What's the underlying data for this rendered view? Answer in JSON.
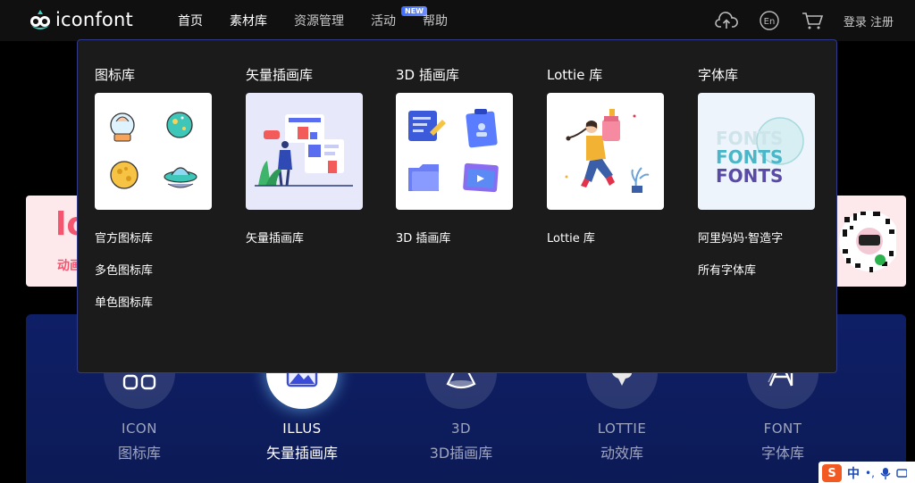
{
  "header": {
    "logo_text": "iconfont",
    "nav": [
      {
        "label": "首页",
        "active": true
      },
      {
        "label": "素材库",
        "active": true
      },
      {
        "label": "资源管理",
        "active": false
      },
      {
        "label": "活动",
        "active": false,
        "badge": "NEW"
      },
      {
        "label": "帮助",
        "active": false
      }
    ],
    "lang_label": "En",
    "login": "登录",
    "register": "注册"
  },
  "dropdown": {
    "columns": [
      {
        "title": "图标库",
        "links": [
          "官方图标库",
          "多色图标库",
          "单色图标库"
        ]
      },
      {
        "title": "矢量插画库",
        "links": [
          "矢量插画库"
        ]
      },
      {
        "title": "3D 插画库",
        "links": [
          "3D 插画库"
        ]
      },
      {
        "title": "Lottie 库",
        "links": [
          "Lottie 库"
        ]
      },
      {
        "title": "字体库",
        "links": [
          "阿里妈妈·智造字",
          "所有字体库"
        ],
        "card_text": [
          "FONTS",
          "FONTS",
          "FONTS"
        ]
      }
    ]
  },
  "banner": {
    "left_big": "lo",
    "left_sub": "动画"
  },
  "categories": [
    {
      "en": "ICON",
      "cn": "图标库",
      "icon": "grid-icon",
      "active": false
    },
    {
      "en": "ILLUS",
      "cn": "矢量插画库",
      "icon": "picture-icon",
      "active": true
    },
    {
      "en": "3D",
      "cn": "3D插画库",
      "icon": "cone-icon",
      "active": false
    },
    {
      "en": "LOTTIE",
      "cn": "动效库",
      "icon": "lottie-icon",
      "active": false
    },
    {
      "en": "FONT",
      "cn": "字体库",
      "icon": "font-icon",
      "active": false
    }
  ],
  "ime": {
    "logo": "S",
    "label": "中"
  }
}
